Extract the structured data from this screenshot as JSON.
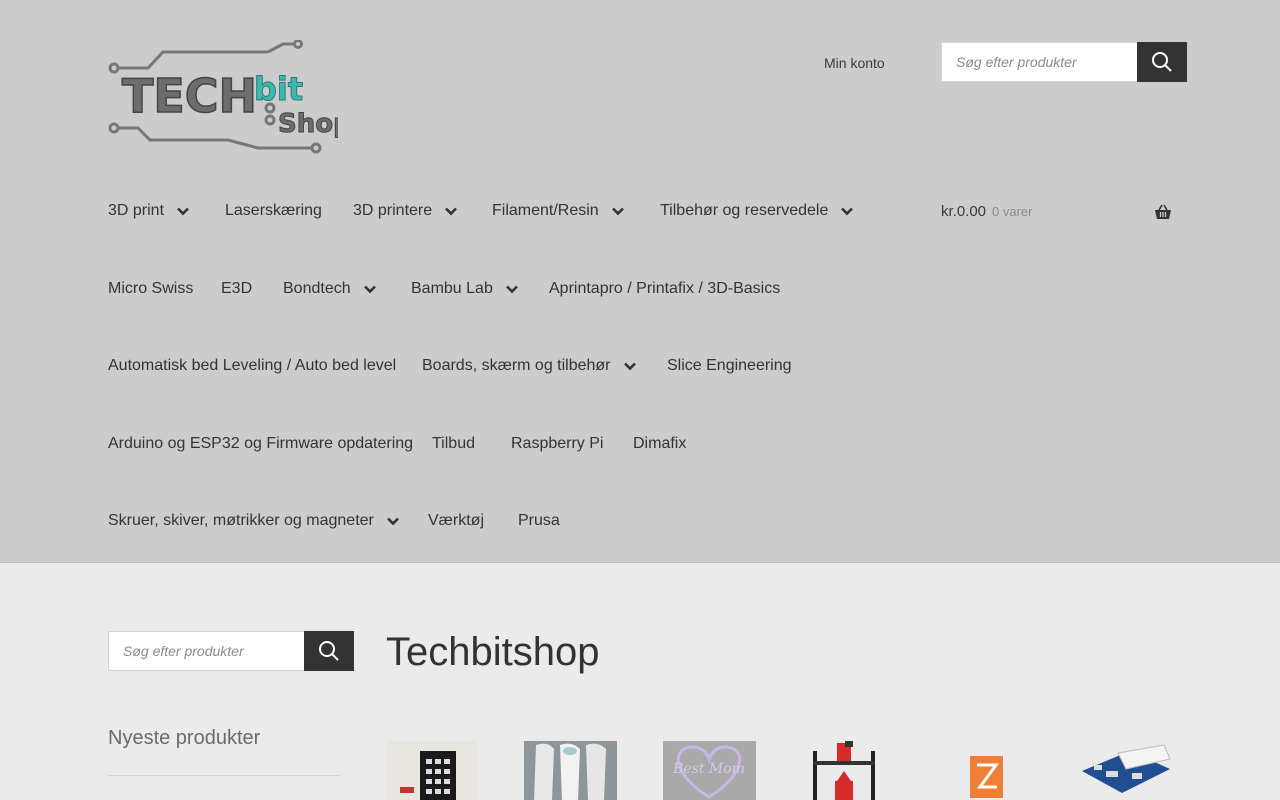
{
  "header": {
    "logo_text_main": "TECH",
    "logo_text_accent": "bit",
    "logo_text_sub": "Shop",
    "account_link": "Min konto",
    "search_placeholder": "Søg efter produkter"
  },
  "cart": {
    "amount": "kr.0.00",
    "count": "0 varer"
  },
  "nav": [
    {
      "label": "3D print",
      "dropdown": true
    },
    {
      "label": "Laserskæring",
      "dropdown": false
    },
    {
      "label": "3D printere",
      "dropdown": true
    },
    {
      "label": "Filament/Resin",
      "dropdown": true
    },
    {
      "label": "Tilbehør og reservedele",
      "dropdown": true
    },
    {
      "label": "Micro Swiss",
      "dropdown": false
    },
    {
      "label": "E3D",
      "dropdown": false
    },
    {
      "label": "Bondtech",
      "dropdown": true
    },
    {
      "label": "Bambu Lab",
      "dropdown": true
    },
    {
      "label": "Aprintapro / Printafix / 3D-Basics",
      "dropdown": false
    },
    {
      "label": "Automatisk bed Leveling / Auto bed level",
      "dropdown": false
    },
    {
      "label": "Boards, skærm og tilbehør",
      "dropdown": true
    },
    {
      "label": "Slice Engineering",
      "dropdown": false
    },
    {
      "label": "Arduino og ESP32 og Firmware opdatering",
      "dropdown": false
    },
    {
      "label": "Tilbud",
      "dropdown": false
    },
    {
      "label": "Raspberry Pi",
      "dropdown": false
    },
    {
      "label": "Dimafix",
      "dropdown": false
    },
    {
      "label": "Skruer, skiver, møtrikker og magneter",
      "dropdown": true
    },
    {
      "label": "Værktøj",
      "dropdown": false
    },
    {
      "label": "Prusa",
      "dropdown": false
    }
  ],
  "sidebar": {
    "search_placeholder": "Søg efter produkter",
    "widget_title": "Nyeste produkter"
  },
  "main": {
    "title": "Techbitshop",
    "products": [
      {
        "icon": "keypad-module-image"
      },
      {
        "icon": "white-vases-image"
      },
      {
        "icon": "best-mom-sign-image",
        "image_text": "Best Mom"
      },
      {
        "icon": "3d-printer-image"
      },
      {
        "icon": "orange-logo-image"
      },
      {
        "icon": "circuit-board-image"
      }
    ]
  },
  "colors": {
    "header_bg": "#cccccc",
    "page_bg": "#ebebeb",
    "button_dark": "#333333",
    "logo_accent": "#3fb8b0"
  }
}
